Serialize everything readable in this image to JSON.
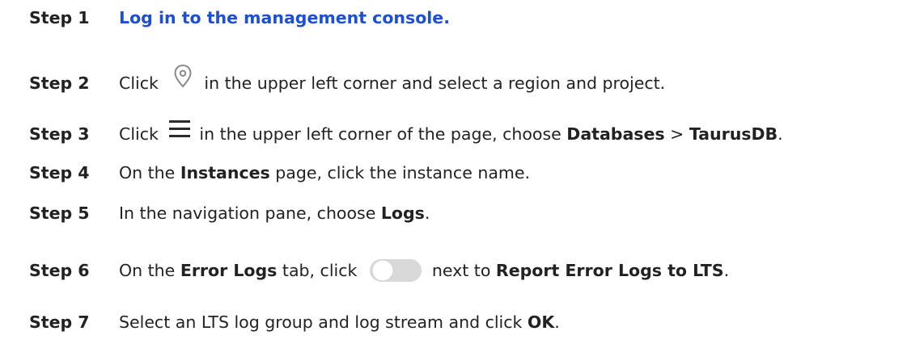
{
  "steps": [
    {
      "label": "Step 1",
      "parts": {
        "link": "Log in to the management console."
      }
    },
    {
      "label": "Step 2",
      "parts": {
        "a": "Click ",
        "b": "in the upper left corner and select a region and project."
      },
      "icon": "location-pin-icon"
    },
    {
      "label": "Step 3",
      "parts": {
        "a": "Click ",
        "b": "in the upper left corner of the page, choose ",
        "c": "Databases",
        "d": " > ",
        "e": "TaurusDB",
        "f": "."
      },
      "icon": "hamburger-menu-icon"
    },
    {
      "label": "Step 4",
      "parts": {
        "a": "On the ",
        "b": "Instances",
        "c": " page, click the instance name."
      }
    },
    {
      "label": "Step 5",
      "parts": {
        "a": "In the navigation pane, choose ",
        "b": "Logs",
        "c": "."
      }
    },
    {
      "label": "Step 6",
      "parts": {
        "a": "On the ",
        "b": "Error Logs",
        "c": " tab, click ",
        "d": "next to ",
        "e": "Report Error Logs to LTS",
        "f": "."
      },
      "icon": "toggle-switch-off-icon"
    },
    {
      "label": "Step 7",
      "parts": {
        "a": "Select an LTS log group and log stream and click ",
        "b": "OK",
        "c": "."
      }
    }
  ],
  "colors": {
    "link": "#1b4fd6",
    "text": "#222222",
    "toggle_track": "#d9d9d9"
  }
}
